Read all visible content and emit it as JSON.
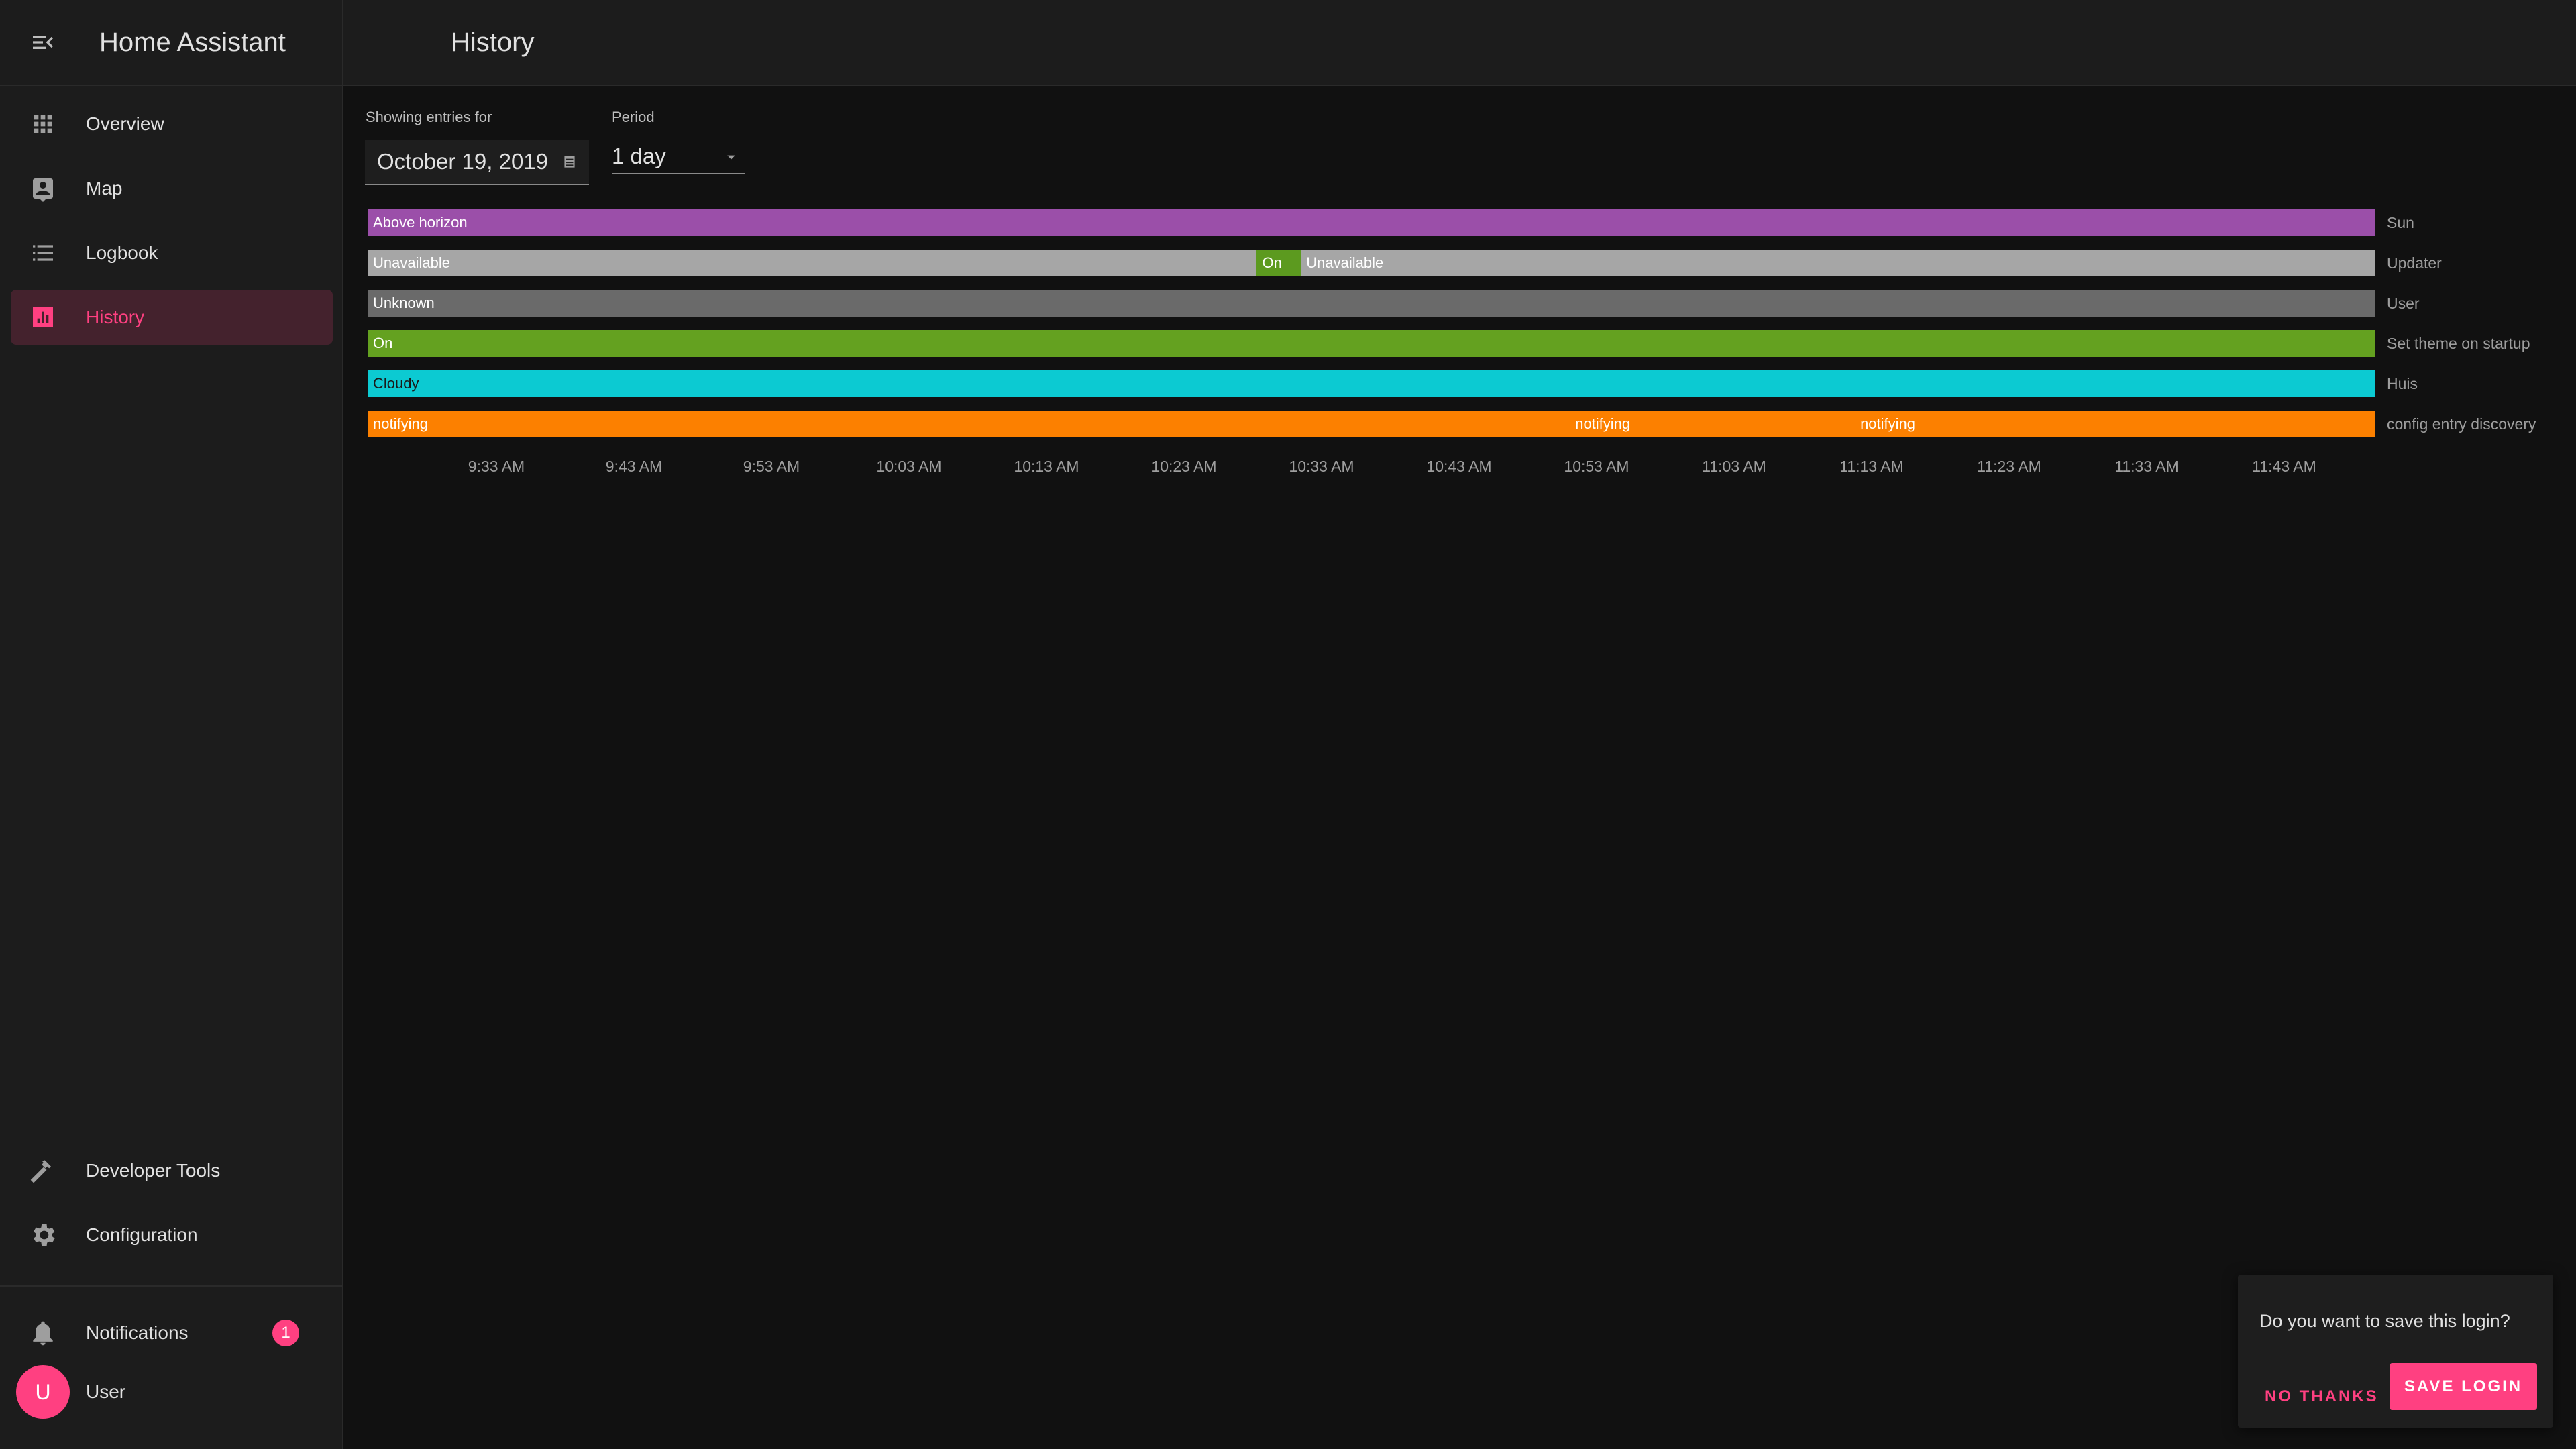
{
  "app": {
    "title": "Home Assistant"
  },
  "header": {
    "title": "History"
  },
  "sidebar": {
    "items": [
      {
        "label": "Overview",
        "icon": "grid-icon"
      },
      {
        "label": "Map",
        "icon": "map-account-icon"
      },
      {
        "label": "Logbook",
        "icon": "list-icon"
      },
      {
        "label": "History",
        "icon": "chart-bar-icon",
        "active": true
      }
    ],
    "bottom_items": [
      {
        "label": "Developer Tools",
        "icon": "hammer-icon"
      },
      {
        "label": "Configuration",
        "icon": "gear-icon"
      }
    ],
    "notifications": {
      "label": "Notifications",
      "count": "1"
    },
    "user": {
      "label": "User",
      "initial": "U"
    }
  },
  "filters": {
    "date_label": "Showing entries for",
    "date_value": "October 19, 2019",
    "period_label": "Period",
    "period_value": "1 day"
  },
  "timeline": {
    "entities": [
      {
        "name": "Sun",
        "segments": [
          {
            "label": "Above horizon",
            "start": 0,
            "end": 1,
            "color": "#9b4fa9",
            "text_color": "#ffffff"
          }
        ]
      },
      {
        "name": "Updater",
        "segments": [
          {
            "label": "Unavailable",
            "start": 0,
            "end": 0.443,
            "color": "#a6a6a6",
            "text_color": "#ffffff"
          },
          {
            "label": "On",
            "start": 0.443,
            "end": 0.465,
            "color": "#5c9a1f",
            "text_color": "#ffffff"
          },
          {
            "label": "Unavailable",
            "start": 0.465,
            "end": 1,
            "color": "#a6a6a6",
            "text_color": "#ffffff"
          }
        ]
      },
      {
        "name": "User",
        "segments": [
          {
            "label": "Unknown",
            "start": 0,
            "end": 1,
            "color": "#6a6a6a",
            "text_color": "#ffffff"
          }
        ]
      },
      {
        "name": "Set theme on startup",
        "segments": [
          {
            "label": "On",
            "start": 0,
            "end": 1,
            "color": "#64a120",
            "text_color": "#ffffff"
          }
        ]
      },
      {
        "name": "Huis",
        "segments": [
          {
            "label": "Cloudy",
            "start": 0,
            "end": 1,
            "color": "#0ccad2",
            "text_color": "#1a1a1a"
          }
        ]
      },
      {
        "name": "config entry discovery",
        "segments": [
          {
            "label": "notifying",
            "start": 0,
            "end": 0.599,
            "color": "#fc8000",
            "text_color": "#ffffff"
          },
          {
            "label": "notifying",
            "start": 0.599,
            "end": 0.741,
            "color": "#fc8000",
            "text_color": "#ffffff"
          },
          {
            "label": "notifying",
            "start": 0.741,
            "end": 1,
            "color": "#fc8000",
            "text_color": "#ffffff"
          }
        ]
      }
    ],
    "ticks": [
      "9:33 AM",
      "9:43 AM",
      "9:53 AM",
      "10:03 AM",
      "10:13 AM",
      "10:23 AM",
      "10:33 AM",
      "10:43 AM",
      "10:53 AM",
      "11:03 AM",
      "11:13 AM",
      "11:23 AM",
      "11:33 AM",
      "11:43 AM"
    ]
  },
  "toast": {
    "message": "Do you want to save this login?",
    "no_label": "NO THANKS",
    "yes_label": "SAVE LOGIN"
  },
  "colors": {
    "accent": "#ff4081"
  }
}
